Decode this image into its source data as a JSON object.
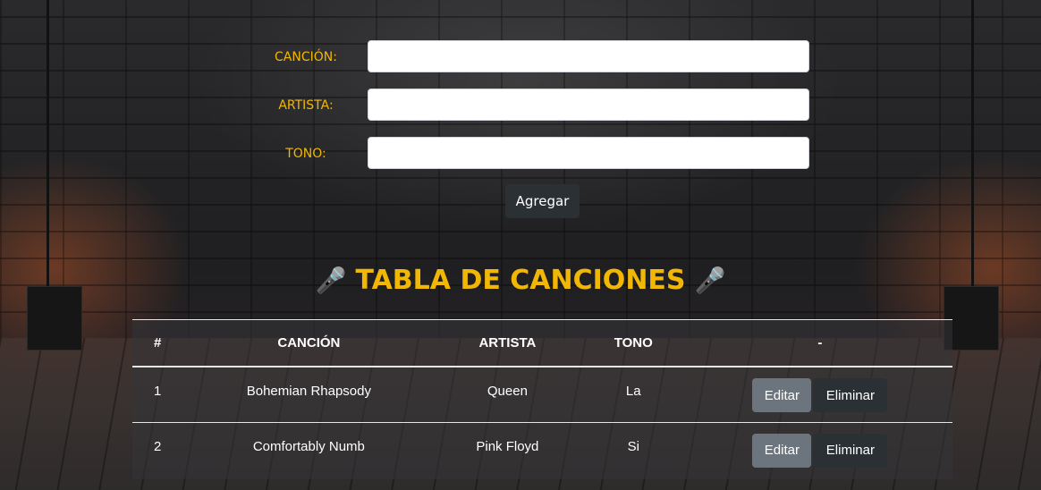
{
  "form": {
    "song_label": "CANCIÓN:",
    "artist_label": "ARTISTA:",
    "tone_label": "TONO:",
    "song_value": "",
    "artist_value": "",
    "tone_value": "",
    "add_button": "Agregar"
  },
  "table": {
    "title": "TABLA DE CANCIONES",
    "title_icon": "🎤",
    "headers": [
      "#",
      "CANCIÓN",
      "ARTISTA",
      "TONO",
      "-"
    ],
    "rows": [
      {
        "num": "1",
        "song": "Bohemian Rhapsody",
        "artist": "Queen",
        "tone": "La",
        "edit": "Editar",
        "delete": "Eliminar"
      },
      {
        "num": "2",
        "song": "Comfortably Numb",
        "artist": "Pink Floyd",
        "tone": "Si",
        "edit": "Editar",
        "delete": "Eliminar"
      }
    ]
  },
  "colors": {
    "accent": "#f2b705",
    "dark_button": "#2b3035",
    "secondary_button": "#6c757d"
  },
  "icons": [
    "microphone-icon"
  ]
}
